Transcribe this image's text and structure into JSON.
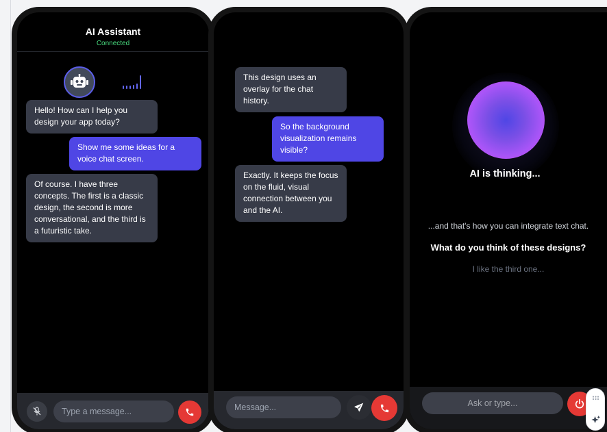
{
  "phone1": {
    "header": {
      "title": "AI Assistant",
      "status": "Connected"
    },
    "messages": [
      {
        "from": "ai",
        "text": "Hello! How can I help you design your app today?"
      },
      {
        "from": "user",
        "text": "Show me some ideas for a voice chat screen."
      },
      {
        "from": "ai",
        "text": "Of course. I have three concepts. The first is a classic design, the second is more conversational, and the third is a futuristic take."
      }
    ],
    "input_placeholder": "Type a message...",
    "icons": {
      "avatar": "robot-icon",
      "visualizer": "audio-level-icon",
      "mute": "mic-off-icon",
      "call": "phone-icon"
    }
  },
  "phone2": {
    "messages": [
      {
        "from": "ai",
        "text": "This design uses an overlay for the chat history."
      },
      {
        "from": "user",
        "text": "So the background visualization remains visible?"
      },
      {
        "from": "ai",
        "text": "Exactly. It keeps the focus on the fluid, visual connection between you and the AI."
      }
    ],
    "input_placeholder": "Message...",
    "icons": {
      "send": "send-icon",
      "call": "phone-icon"
    }
  },
  "phone3": {
    "status": "AI is thinking...",
    "transcript_line": "...and that's how you can integrate text chat.",
    "question": "What do you think of these designs?",
    "user_reply": "I like the third one...",
    "input_placeholder": "Ask or type...",
    "icons": {
      "orb": "ai-orb",
      "end": "power-icon"
    }
  },
  "widget": {
    "icons": [
      "drag-handle-icon",
      "sparkle-icon"
    ]
  },
  "colors": {
    "accent": "#4f46e5",
    "ai_bubble": "#373b48",
    "connected": "#4ade80",
    "call_red": "#e53935",
    "background": "#000000"
  }
}
